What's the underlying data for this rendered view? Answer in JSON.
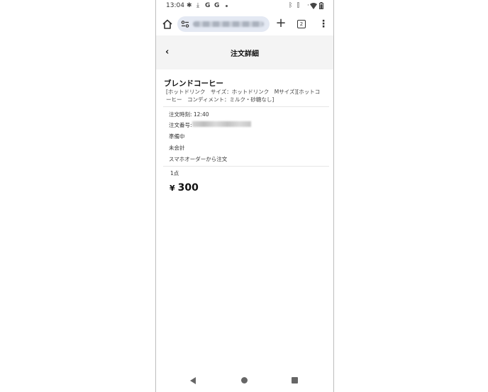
{
  "status_bar": {
    "time": "13:04",
    "left_icons": [
      "gear-icon",
      "download-icon",
      "google-g-icon",
      "google-g-icon",
      "notification-dot-icon"
    ],
    "right_icons": [
      "bluetooth-icon",
      "vibrate-icon",
      "wifi-icon",
      "battery-icon"
    ],
    "g_letter": "G"
  },
  "browser": {
    "tab_count": "2",
    "plus_glyph": "+",
    "menu_glyph": "⋮"
  },
  "header": {
    "title": "注文詳細",
    "back_glyph": "‹"
  },
  "order": {
    "product_name": "ブレンドコーヒー",
    "options": "[ホットドリンク　サイズ：ホットドリンク　Mサイズ][ホットコーヒー　コンディメント：ミルク・砂糖なし]",
    "time_label": "注文時刻: 12:40",
    "number_label": "注文番号:",
    "status": "準備中",
    "payment": "未会計",
    "source": "スマホオーダーから注文",
    "quantity": "1点",
    "currency": "¥",
    "price": "300"
  },
  "colors": {
    "header_bg": "#f4f4f4",
    "url_pill_bg": "#e4e9f3"
  }
}
